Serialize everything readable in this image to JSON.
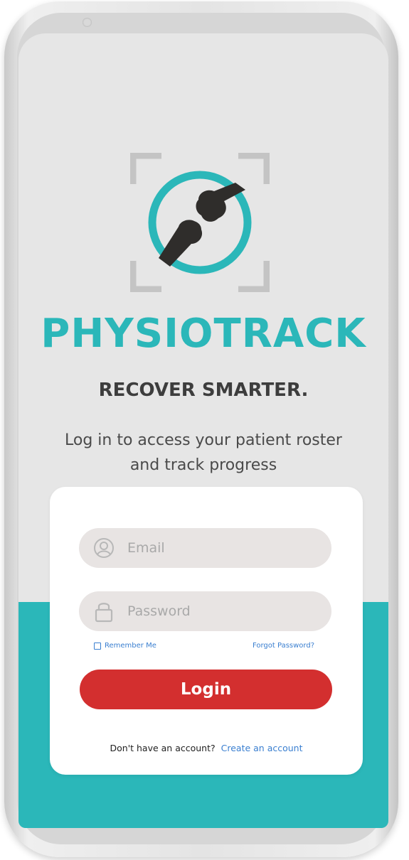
{
  "app": {
    "brand": "PHYSIOTRACK",
    "tagline": "RECOVER SMARTER.",
    "subtitle": "Log in to access your patient roster and track progress"
  },
  "login_form": {
    "email_placeholder": "Email",
    "password_placeholder": "Password",
    "remember_label": "Remember Me",
    "forgot_label": "Forgot Password?",
    "submit_label": "Login",
    "signup_prompt": "Don't have an account?",
    "signup_link": "Create an account"
  },
  "icons": {
    "logo": "joint-bone-logo",
    "email": "user-icon",
    "password": "lock-icon"
  },
  "colors": {
    "accent": "#2bb7b9",
    "button": "#d32f2f",
    "link": "#3a7fd0",
    "screen_bg": "#e6e6e6"
  }
}
